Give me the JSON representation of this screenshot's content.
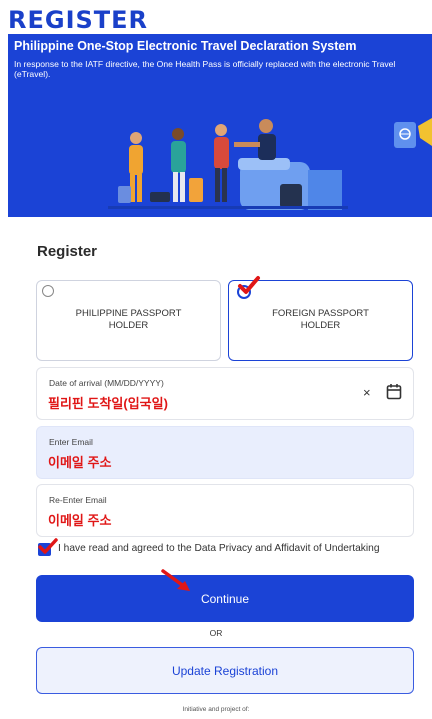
{
  "header": {
    "title": "REGISTER"
  },
  "banner": {
    "title": "Philippine One-Stop Electronic Travel Declaration System",
    "subtitle": "In response to the IATF directive, the One Health Pass is officially replaced with the electronic Travel (eTravel)."
  },
  "form": {
    "section_title": "Register",
    "passport_options": [
      {
        "line1": "PHILIPPINE PASSPORT",
        "line2": "HOLDER",
        "selected": false
      },
      {
        "line1": "FOREIGN PASSPORT",
        "line2": "HOLDER",
        "selected": true
      }
    ],
    "arrival": {
      "label": "Date of arrival (MM/DD/YYYY)",
      "value": "필리핀 도착일(입국일)",
      "clear": "×",
      "calendar_icon": "calendar-icon"
    },
    "email": {
      "label": "Enter Email",
      "value": "이메일 주소"
    },
    "reemail": {
      "label": "Re-Enter Email",
      "value": "이메일 주소"
    },
    "consent": {
      "text": "I have read and agreed to the Data Privacy and Affidavit of Undertaking",
      "checked": true
    },
    "continue_label": "Continue",
    "or_label": "OR",
    "update_label": "Update Registration",
    "initiative": "Initiative and project of:"
  },
  "colors": {
    "primary": "#1b43d6",
    "annotation": "#e01616",
    "field_fill": "#e9eefd"
  }
}
